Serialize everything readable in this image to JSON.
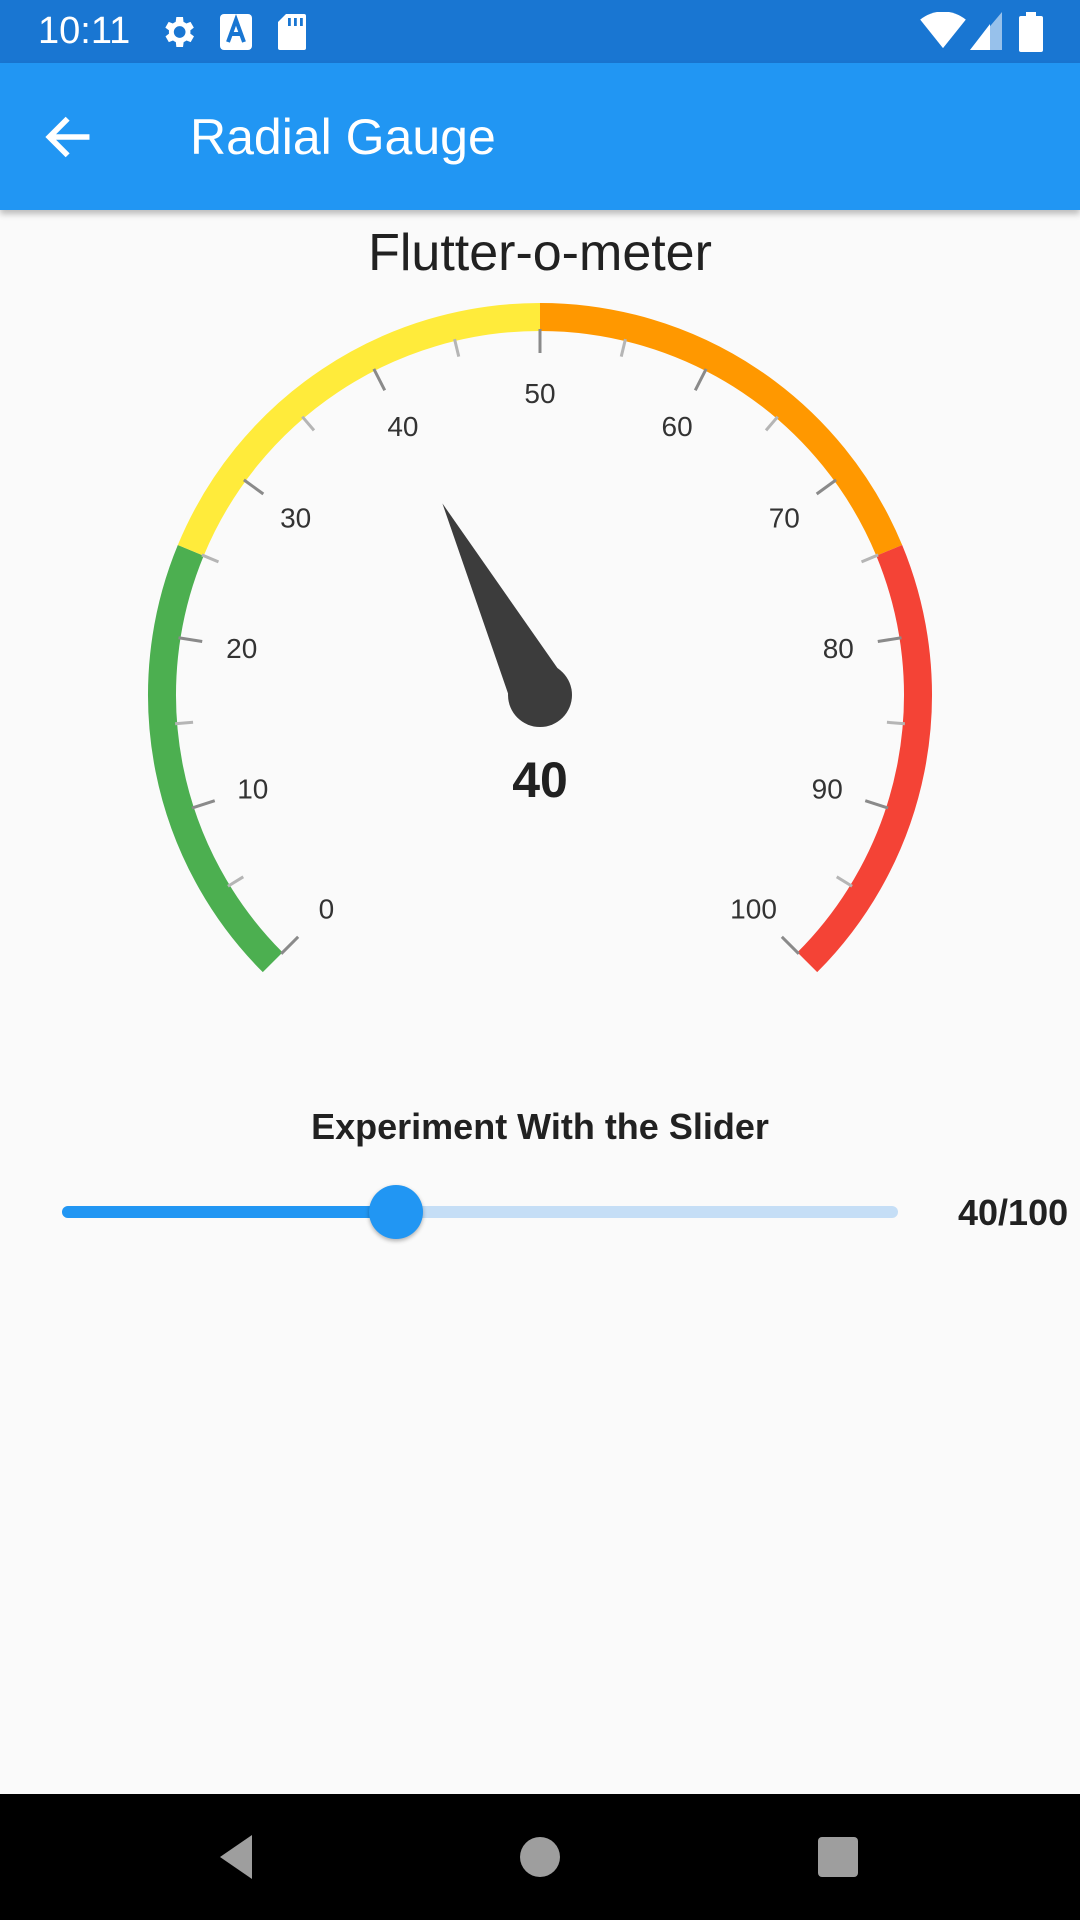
{
  "status_bar": {
    "time": "10:11",
    "icons": [
      "gear-icon",
      "text-a-icon",
      "sd-card-icon",
      "wifi-icon",
      "signal-icon",
      "battery-icon"
    ],
    "color": "#1976d2"
  },
  "app_bar": {
    "title": "Radial Gauge",
    "back_icon": "arrow-back-icon",
    "color": "#2196f3"
  },
  "gauge": {
    "title": "Flutter-o-meter",
    "value": 40,
    "value_label": "40",
    "min": 0,
    "max": 100,
    "major_ticks": [
      "0",
      "10",
      "20",
      "30",
      "40",
      "50",
      "60",
      "70",
      "80",
      "90",
      "100"
    ],
    "minor_tick_step": 5,
    "ranges": [
      {
        "from": 0,
        "to": 25,
        "color": "#4caf50"
      },
      {
        "from": 25,
        "to": 50,
        "color": "#ffeb3b"
      },
      {
        "from": 50,
        "to": 75,
        "color": "#ff9800"
      },
      {
        "from": 75,
        "to": 100,
        "color": "#f44336"
      }
    ],
    "needle_color": "#3c3c3c"
  },
  "slider": {
    "title": "Experiment With the Slider",
    "value": 40,
    "max": 100,
    "value_label": "40/100",
    "active_color": "#2196f3",
    "inactive_color": "#c5def6"
  },
  "nav_bar": {
    "icons": [
      "back-triangle-icon",
      "home-circle-icon",
      "recents-square-icon"
    ]
  }
}
